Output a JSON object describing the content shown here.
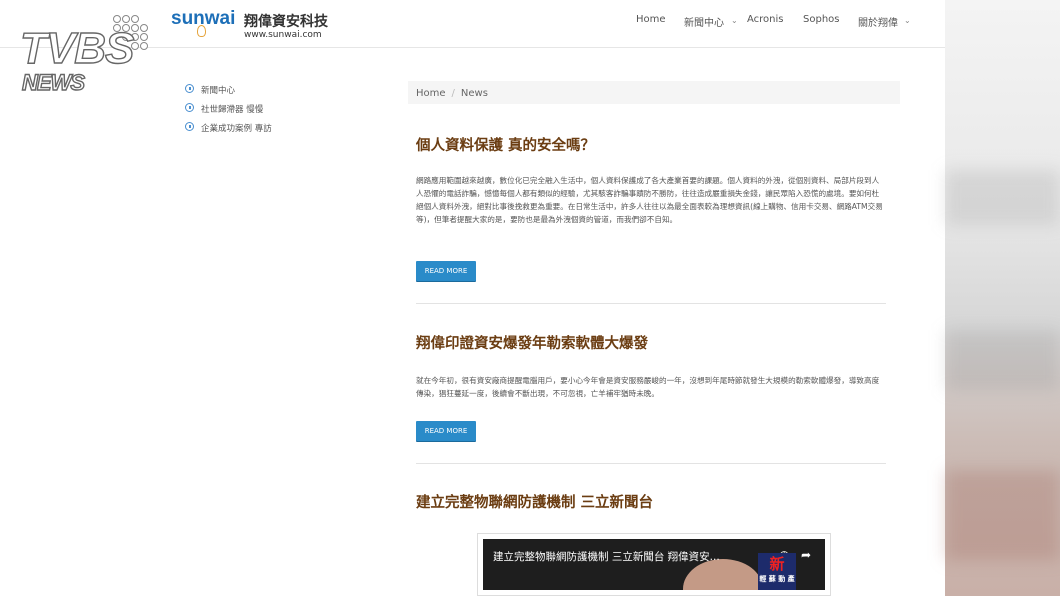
{
  "watermark": {
    "line1": "TVBS",
    "line2": "NEWS"
  },
  "logo": {
    "brand": "sunwai",
    "name": "翔偉資安科技",
    "url": "www.sunwai.com"
  },
  "nav": [
    {
      "label": "Home"
    },
    {
      "label": "新聞中心",
      "dropdown": true
    },
    {
      "label": "Acronis"
    },
    {
      "label": "Sophos"
    },
    {
      "label": "關於翔偉",
      "dropdown": true
    }
  ],
  "sidebar": [
    {
      "label": "新聞中心"
    },
    {
      "label": "社世歸滯器 慢慢"
    },
    {
      "label": "企業成功案例 專訪"
    }
  ],
  "breadcrumb": {
    "home": "Home",
    "separator": "/",
    "current": "News"
  },
  "posts": [
    {
      "title": "個人資料保護 真的安全嗎？",
      "body": "網路應用範圍越來越廣，數位化已完全融入生活中，個人資料保護成了各大產業首要的課題。個人資料的外洩，從個別資料、局部片段到人人恐懼的電話詐騙，憾憶每個人都有類似的經驗，尤其駭客詐騙事蹟防不勝防，往往造成嚴重損失金錢，讓民眾陷入恐慌的處境。要如何杜絕個人資料外洩，絕對比事後挽救更為重要。在日常生活中，許多人往往以為最全面表較為理想資訊(線上購物、信用卡交易、網路ATM交易等)，但筆者提醒大家的是，要防也是最為外洩個資的管道，而我們卻不自知。",
      "button": "READ MORE"
    },
    {
      "title": "翔偉印證資安爆發年勒索軟體大爆發",
      "body": "就在今年初，很有資安廠商提醒電腦用戶，要小心今年會是資安服務嚴峻的一年，沒想到年尾時節就發生大規模的勒索軟體爆發，導致高度傳染，猖狂蔓延一度，後續會不斷出現，不可忽視，亡羊補牢猶時未晚。",
      "button": "READ MORE"
    },
    {
      "title": "建立完整物聯網防護機制 三立新聞台"
    }
  ],
  "video": {
    "title": "建立完整物聯網防護機制 三立新聞台 翔偉資安...",
    "badge": "新",
    "badge_sub": "輕 蘇 動 產"
  },
  "colors": {
    "accent": "#2a8bc9",
    "title": "#6b3d12",
    "logo": "#1d6fb8"
  }
}
